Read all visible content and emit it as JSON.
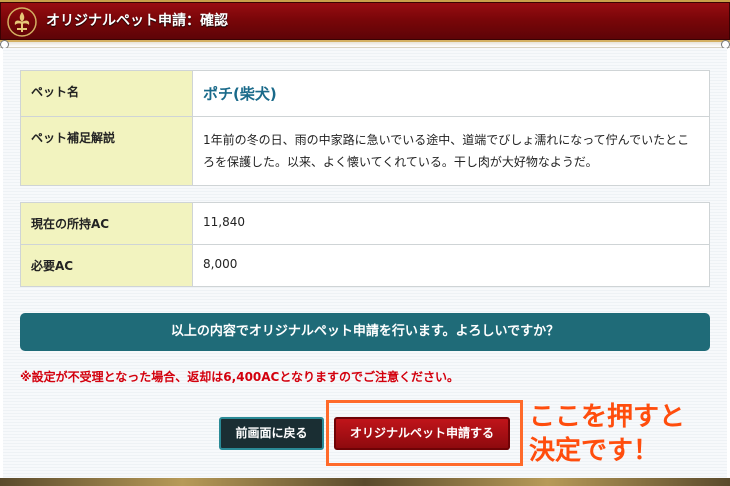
{
  "header": {
    "title": "オリジナルペット申請：確認",
    "emblem_icon": "fleur-de-lis-icon"
  },
  "pet_table": {
    "rows": [
      {
        "label": "ペット名",
        "value": "ポチ(柴犬)"
      },
      {
        "label": "ペット補足解説",
        "value": "1年前の冬の日、雨の中家路に急いでいる途中、道端でびしょ濡れになって佇んでいたところを保護した。以来、よく懐いてくれている。干し肉が大好物なようだ。"
      }
    ]
  },
  "ac_table": {
    "rows": [
      {
        "label": "現在の所持AC",
        "value": "11,840"
      },
      {
        "label": "必要AC",
        "value": "8,000"
      }
    ]
  },
  "confirm_message": "以上の内容でオリジナルペット申請を行います。よろしいですか？",
  "notice": "※設定が不受理となった場合、返却は6,400ACとなりますのでご注意ください。",
  "buttons": {
    "back_label": "前画面に戻る",
    "submit_label": "オリジナルペット申請する"
  },
  "annotation": {
    "line1": "ここを押すと",
    "line2": "決定です！"
  },
  "colors": {
    "header_red": "#7a0609",
    "label_bg": "#f2f3bf",
    "confirm_bar": "#1f6b78",
    "notice_red": "#d3000d",
    "annotation_orange": "#ff4d0d"
  }
}
